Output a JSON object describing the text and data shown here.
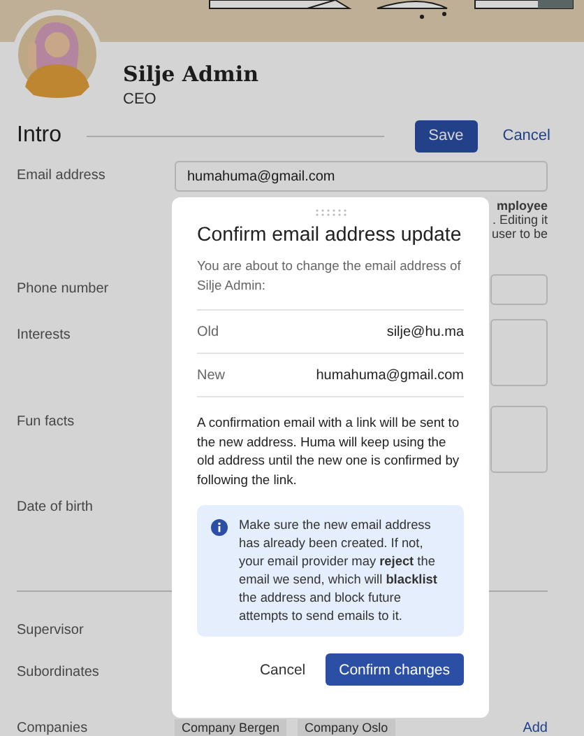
{
  "profile": {
    "name": "Silje Admin",
    "role": "CEO"
  },
  "section": {
    "title": "Intro",
    "save": "Save",
    "cancel": "Cancel"
  },
  "fields": [
    {
      "label": "Email address",
      "kind": "input",
      "value": "humahuma@gmail.com"
    },
    {
      "label": "Phone number",
      "kind": "input"
    },
    {
      "label": "Interests",
      "kind": "textarea"
    },
    {
      "label": "Fun facts",
      "kind": "textarea"
    },
    {
      "label": "Date of birth",
      "kind": "none"
    }
  ],
  "helper_lines": [
    {
      "text": "mployee",
      "bold": true
    },
    {
      "text": ". Editing it",
      "bold": false
    },
    {
      "text": "user to be",
      "bold": false
    }
  ],
  "relations": [
    {
      "label": "Supervisor"
    },
    {
      "label": "Subordinates"
    }
  ],
  "companies": {
    "label": "Companies",
    "tags": [
      "Company Bergen",
      "Company Oslo"
    ],
    "add": "Add"
  },
  "dialog": {
    "title": "Confirm email address update",
    "intro": "You are about to change the email address of Silje Admin:",
    "rows": [
      {
        "label": "Old",
        "value": "silje@hu.ma"
      },
      {
        "label": "New",
        "value": "humahuma@gmail.com"
      }
    ],
    "message": "A confirmation email with a link will be sent to the new address. Huma will keep using the old address until the new one is confirmed by following the link.",
    "notice": "Make sure the new email address has already been created. If not, your email provider may **reject** the email we send, which will **blacklist** the address and block future attempts to send emails to it.",
    "cancel": "Cancel",
    "confirm": "Confirm changes"
  }
}
